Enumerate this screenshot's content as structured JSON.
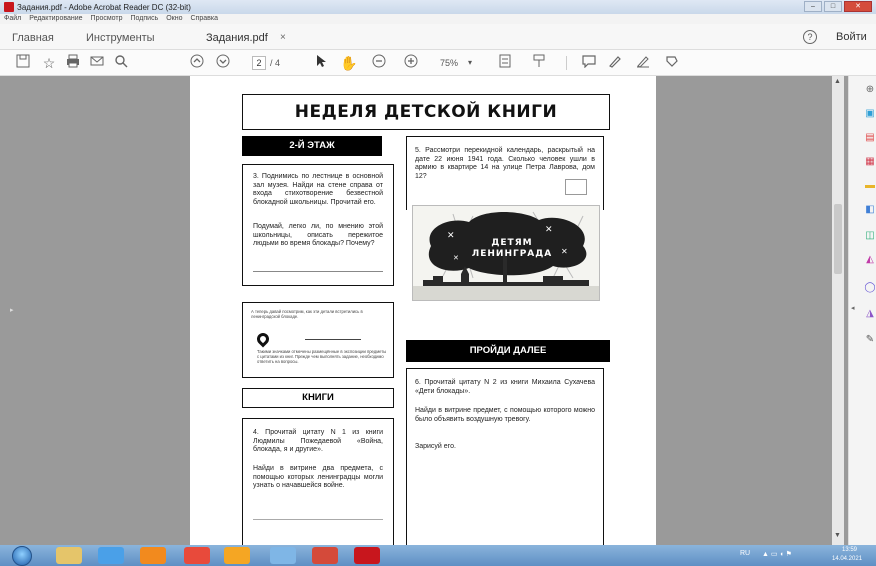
{
  "window": {
    "title": "Задания.pdf - Adobe Acrobat Reader DC (32-bit)",
    "controls": {
      "minimize": "–",
      "maximize": "□",
      "close": "✕"
    }
  },
  "menu": [
    "Файл",
    "Редактирование",
    "Просмотр",
    "Подпись",
    "Окно",
    "Справка"
  ],
  "tabs": {
    "home": "Главная",
    "tools": "Инструменты",
    "document": "Задания.pdf",
    "close": "×"
  },
  "header": {
    "help": "?",
    "signin": "Войти"
  },
  "toolbar": {
    "page_current": "2",
    "page_total": "/ 4",
    "zoom": "75%",
    "zoom_arrow": "▾"
  },
  "document": {
    "title": "НЕДЕЛЯ ДЕТСКОЙ КНИГИ",
    "floor_header": "2-Й ЭТАЖ",
    "task3": "3. Поднимись по лестнице в основной зал музея. Найди на стене справа от входа стихотворение безвестной блокадной школьницы. Прочитай его.",
    "task3_question": "Подумай, легко ли, по мнению этой школьницы, описать пережитое людьми во время блокады? Почему?",
    "note_text": "А теперь давай посмотрим, как эти детали встретились в ленинградской блокаде.",
    "note_text2": "Такими значками отмечены размещённые в экспозиции предметы с цитатами из книг. Прежде чем выполнять задание, необходимо ответить на вопросы.",
    "books_header": "КНИГИ",
    "task4": "4. Прочитай цитату N 1 из книги Людмилы Пожедаевой «Война, блокада, я и другие».",
    "task4_b": "Найди в витрине два предмета, с помощью которых ленинградцы могли узнать о начавшейся войне.",
    "task5": "5. Рассмотри перекидной календарь, раскрытый на дате 22 июня 1941 года. Сколько человек ушли в армию в квартире 14 на улице Петра Лаврова, дом 12?",
    "illustration_text": "ДЕТЯМ ЛЕНИНГРАДА",
    "next_header": "ПРОЙДИ ДАЛЕЕ",
    "task6": "6. Прочитай цитату N 2 из книги Михаила Сухачева «Дети блокады».",
    "task6_b": "Найди в витрине предмет, с помощью которого можно было объявить воздушную тревогу.",
    "task6_c": "Зарисуй его."
  },
  "taskbar": {
    "lang": "RU",
    "time": "13:59",
    "date": "14.04.2021"
  }
}
